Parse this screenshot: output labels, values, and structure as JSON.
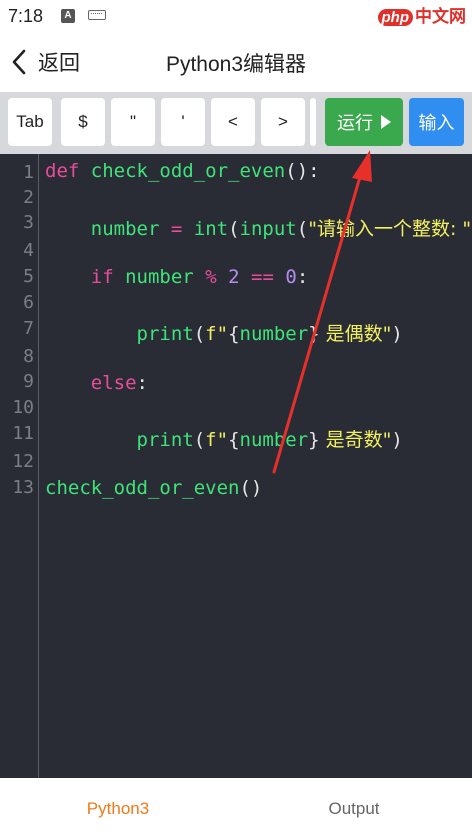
{
  "status_bar": {
    "time": "7:18",
    "notif_icon_letter": "A",
    "watermark_php": "php",
    "watermark_site": "中文网"
  },
  "header": {
    "back_label": "返回",
    "title": "Python3编辑器"
  },
  "toolbar": {
    "keys": [
      "Tab",
      "$",
      "\"",
      "'",
      "<",
      ">"
    ],
    "run_label": "运行",
    "input_label": "输入",
    "run_color": "#3aa84c",
    "input_color": "#2f8ef0"
  },
  "editor": {
    "line_numbers": [
      "1",
      "2",
      "3",
      "4",
      "5",
      "6",
      "7",
      "8",
      "9",
      "10",
      "11",
      "12",
      "13"
    ],
    "lines": {
      "l1": {
        "kw_def": "def",
        "fn_name": "check_odd_or_even",
        "paren": "():"
      },
      "l3": {
        "var": "number",
        "eq": "=",
        "fn_int": "int",
        "p1": "(",
        "fn_input": "input",
        "p2": "(",
        "str": "\"请输入一个整数: \"",
        "p3": "))"
      },
      "l5": {
        "kw_if": "if",
        "var": "number",
        "mod": "%",
        "two": "2",
        "eqeq": "==",
        "zero": "0",
        "colon": ":"
      },
      "l7": {
        "fn_print": "print",
        "p1": "(",
        "fpre": "f\"",
        "brace_open": "{",
        "var": "number",
        "brace_close": "}",
        "str_tail": " 是偶数\"",
        "p2": ")"
      },
      "l9": {
        "kw_else": "else",
        "colon": ":"
      },
      "l11": {
        "fn_print": "print",
        "p1": "(",
        "fpre": "f\"",
        "brace_open": "{",
        "var": "number",
        "brace_close": "}",
        "str_tail": " 是奇数\"",
        "p2": ")"
      },
      "l13": {
        "fn_name": "check_odd_or_even",
        "paren": "()"
      }
    }
  },
  "bottom_tabs": {
    "python3": "Python3",
    "output": "Output",
    "active_color": "#f07a1a"
  },
  "annotation": {
    "arrow_color": "#e8302a"
  }
}
